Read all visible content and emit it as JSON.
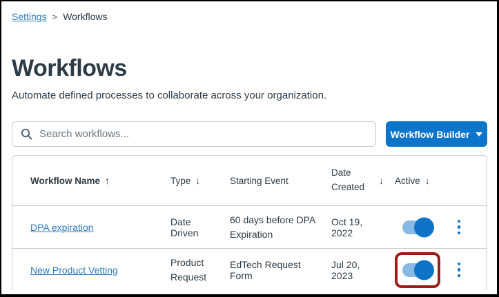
{
  "breadcrumb": {
    "separator": ">",
    "items": [
      {
        "label": "Settings"
      },
      {
        "label": "Workflows"
      }
    ]
  },
  "header": {
    "title": "Workflows",
    "subtitle": "Automate defined processes to collaborate across your organization."
  },
  "toolbar": {
    "search_placeholder": "Search workflows...",
    "builder_button_label": "Workflow Builder"
  },
  "icons": {
    "search": "magnifying-glass",
    "sort_asc_glyph": "↑",
    "sort_desc_glyph": "↓",
    "kebab": "vertical-three-dots"
  },
  "table": {
    "columns": [
      {
        "label": "Workflow Name",
        "sort": "asc"
      },
      {
        "label": "Type",
        "sort": "desc"
      },
      {
        "label": "Starting Event",
        "sort": null
      },
      {
        "label": "Date Created",
        "sort": "desc"
      },
      {
        "label": "Active",
        "sort": "desc"
      }
    ],
    "rows": [
      {
        "name": "DPA expiration",
        "type": "Date Driven",
        "starting_event": "60 days before DPA Expiration",
        "date_created": "Oct 19, 2022",
        "active": true,
        "highlighted": false
      },
      {
        "name": "New Product Vetting",
        "type": "Product Request",
        "starting_event": "EdTech Request Form",
        "date_created": "Jul 20, 2023",
        "active": true,
        "highlighted": true
      }
    ]
  },
  "colors": {
    "text": "#2D3B45",
    "link_blue": "#2B7ABC",
    "button_blue": "#0B74CB",
    "toggle_track": "#87B9E4",
    "toggle_knob": "#0E74C7",
    "table_border": "#C7CDD1",
    "annotation_red": "#9B1F16",
    "frame_black": "#000000"
  }
}
